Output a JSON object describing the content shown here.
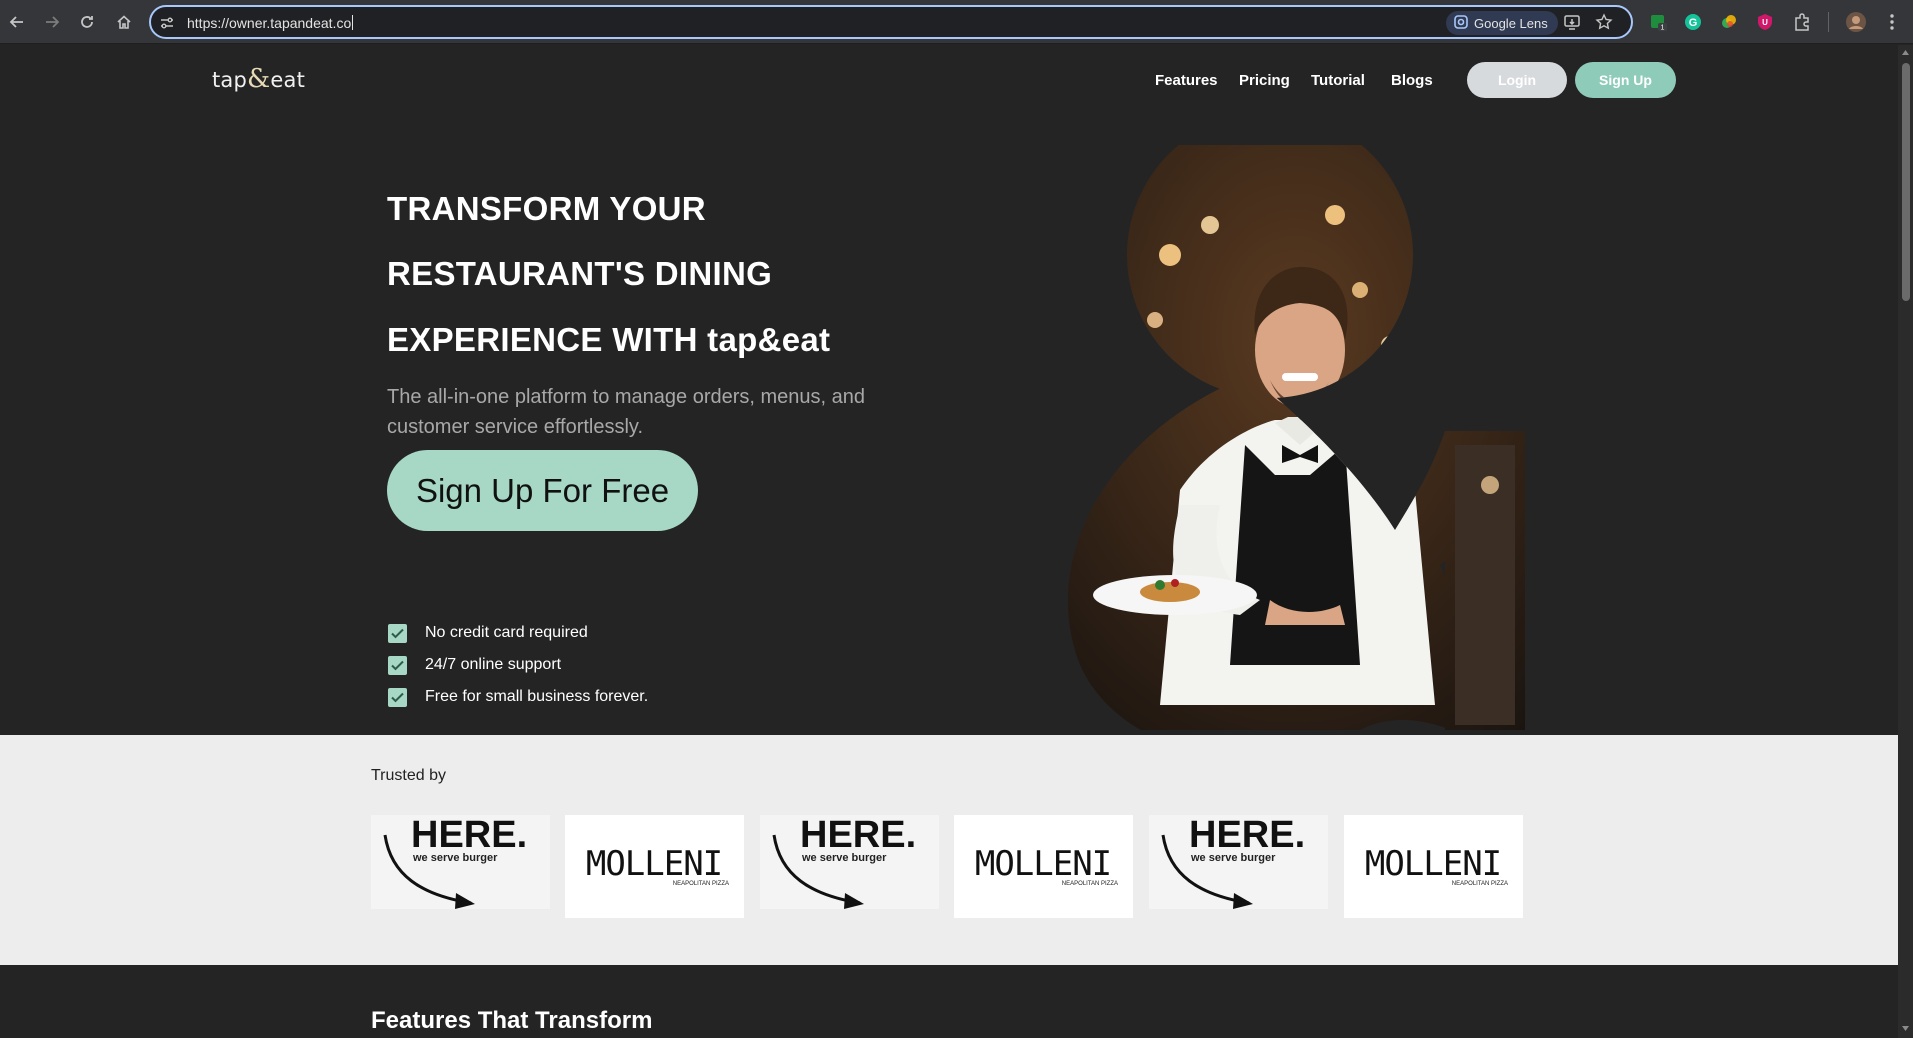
{
  "browser": {
    "url": "https://owner.tapandeat.co",
    "lens_label": "Google Lens",
    "icons": [
      "back-icon",
      "forward-icon",
      "reload-icon",
      "home-icon",
      "site-settings-icon",
      "install-icon",
      "star-icon",
      "extension-icon",
      "profile-avatar",
      "menu-icon"
    ]
  },
  "header": {
    "logo_left": "tap",
    "logo_amp": "&",
    "logo_right": "eat",
    "nav": [
      "Features",
      "Pricing",
      "Tutorial",
      "Blogs"
    ],
    "login_label": "Login",
    "signup_label": "Sign Up"
  },
  "hero": {
    "title_lines": [
      "TRANSFORM YOUR",
      "RESTAURANT'S DINING",
      "EXPERIENCE WITH tap&eat"
    ],
    "subtitle": "The all-in-one platform to manage orders, menus, and customer service effortlessly.",
    "cta_label": "Sign Up For Free",
    "checks": [
      "No credit card required",
      "24/7 online support",
      "Free for small business forever."
    ]
  },
  "trusted": {
    "label": "Trusted by",
    "logos": [
      {
        "name": "HERE.",
        "tagline": "we serve burger"
      },
      {
        "name": "MOLLENI",
        "tagline": "NEAPOLITAN PIZZA"
      },
      {
        "name": "HERE.",
        "tagline": "we serve burger"
      },
      {
        "name": "MOLLENI",
        "tagline": "NEAPOLITAN PIZZA"
      },
      {
        "name": "HERE.",
        "tagline": "we serve burger"
      },
      {
        "name": "MOLLENI",
        "tagline": "NEAPOLITAN PIZZA"
      }
    ]
  },
  "features": {
    "title": "Features That Transform"
  },
  "colors": {
    "page_bg": "#242424",
    "accent": "#a6d8c5",
    "signup_pill": "#8fcbb9",
    "trusted_bg": "#ededed"
  }
}
